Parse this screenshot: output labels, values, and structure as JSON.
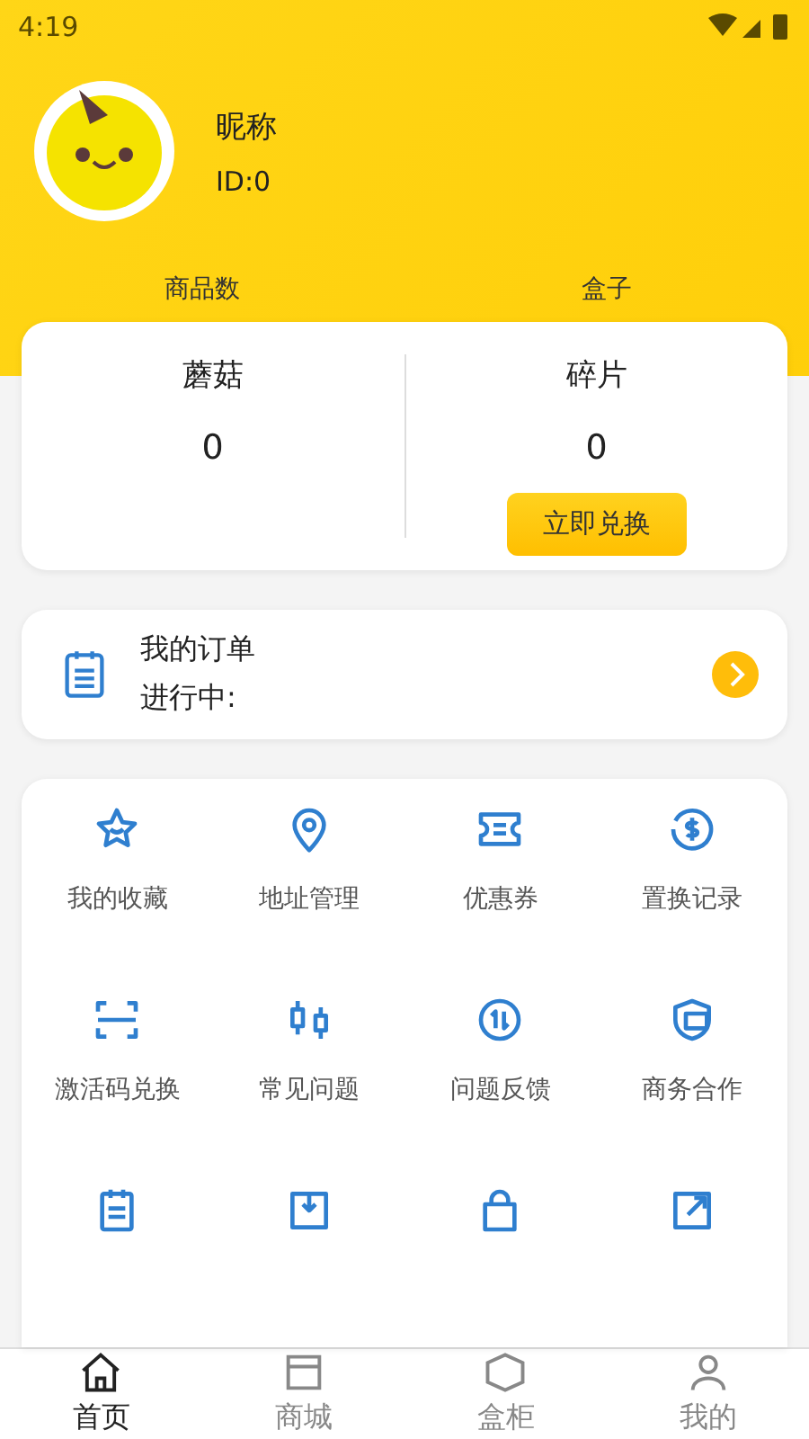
{
  "status_bar": {
    "time": "4:19"
  },
  "profile": {
    "nickname": "昵称",
    "id": "ID:0"
  },
  "header_stats": [
    "商品数",
    "盒子"
  ],
  "balance": [
    {
      "label": "蘑菇",
      "value": "0"
    },
    {
      "label": "碎片",
      "value": "0",
      "action": "立即兑换"
    }
  ],
  "orders": {
    "title": "我的订单",
    "status": "进行中:"
  },
  "menu": [
    "我的收藏",
    "地址管理",
    "优惠券",
    "置换记录",
    "激活码兑换",
    "常见问题",
    "问题反馈",
    "商务合作"
  ],
  "tabs": [
    {
      "label": "首页",
      "selected": true
    },
    {
      "label": "商城",
      "selected": false
    },
    {
      "label": "盒柜",
      "selected": false
    },
    {
      "label": "我的",
      "selected": false
    }
  ]
}
